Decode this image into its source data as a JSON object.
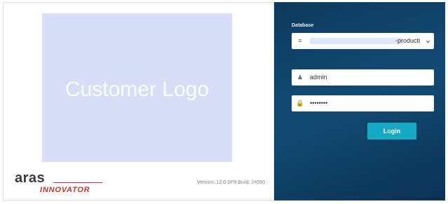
{
  "logo": {
    "text": "Customer Logo"
  },
  "brand": {
    "name": "aras",
    "product": "INNOVATOR"
  },
  "version": "Version: 12.0 SP9 Build: 24090",
  "database": {
    "label": "Database",
    "value_suffix": "-producti",
    "icon": "list-icon",
    "chevron": "chevron-down-icon"
  },
  "username": {
    "value": "admin",
    "icon": "user-icon"
  },
  "password": {
    "value": "••••••••",
    "icon": "lock-icon"
  },
  "login_button": "Login",
  "colors": {
    "panel": "#124a73",
    "accent": "#17a9c4",
    "logo_bg": "#d8ddf8"
  }
}
